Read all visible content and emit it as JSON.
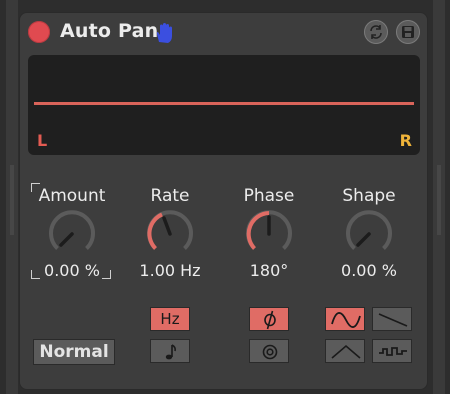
{
  "device": {
    "title": "Auto Pan",
    "power_icon": "power-toggle",
    "hot_swap_icon": "hand-icon",
    "header_buttons": [
      "hot-swap-icon",
      "save-icon"
    ]
  },
  "display": {
    "left_label": "L",
    "right_label": "R",
    "colors": {
      "line": "#d9645a",
      "left": "#e35b52",
      "right": "#f0b43a"
    }
  },
  "knobs": [
    {
      "id": "amount",
      "title": "Amount",
      "value": "0.00 %",
      "level": 0.0
    },
    {
      "id": "rate",
      "title": "Rate",
      "value": "1.00 Hz",
      "level": 0.3
    },
    {
      "id": "phase",
      "title": "Phase",
      "value": "180°",
      "level": 0.5
    },
    {
      "id": "shape",
      "title": "Shape",
      "value": "0.00 %",
      "level": 0.0
    }
  ],
  "buttons": {
    "rate_hz": {
      "label": "Hz",
      "active": true
    },
    "rate_sync": {
      "icon": "note-icon",
      "active": false
    },
    "phase": {
      "icon": "phase-icon",
      "active": true
    },
    "spin": {
      "icon": "spin-icon",
      "active": false
    },
    "normal": {
      "label": "Normal"
    },
    "waveforms": [
      {
        "icon": "sine-wave-icon",
        "active": true
      },
      {
        "icon": "sawtooth-wave-icon",
        "active": false
      },
      {
        "icon": "triangle-wave-icon",
        "active": false
      },
      {
        "icon": "random-wave-icon",
        "active": false
      }
    ]
  },
  "colors": {
    "accent": "#e06c65",
    "knob_ring": "#5b5b5b",
    "panel": "#3d3d3d"
  }
}
